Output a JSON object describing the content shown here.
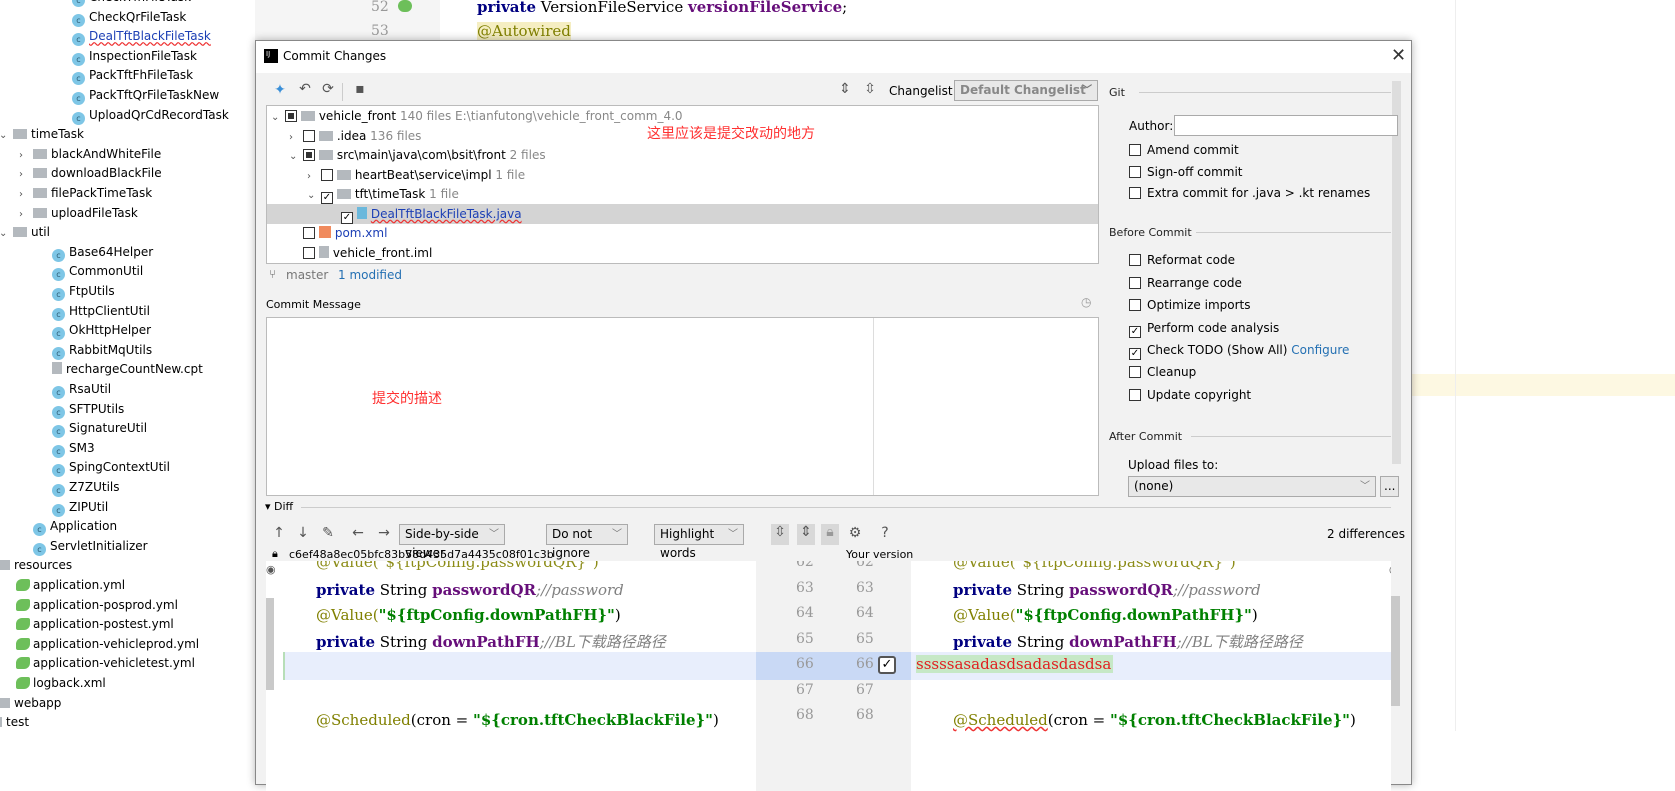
{
  "project_tree": {
    "items": [
      {
        "label": "CheckTfhFileTask",
        "icon": "class-icon"
      },
      {
        "label": "CheckQrFileTask",
        "icon": "class-icon"
      },
      {
        "label": "DealTftBlackFileTask",
        "icon": "class-icon"
      },
      {
        "label": "InspectionFileTask",
        "icon": "class-icon"
      },
      {
        "label": "PackTftFhFileTask",
        "icon": "class-icon"
      },
      {
        "label": "PackTftQrFileTaskNew",
        "icon": "class-icon"
      },
      {
        "label": "UploadQrCdRecordTask",
        "icon": "class-icon"
      },
      {
        "label": "timeTask",
        "icon": "folder-icon"
      },
      {
        "label": "blackAndWhiteFile",
        "icon": "folder-icon"
      },
      {
        "label": "downloadBlackFile",
        "icon": "folder-icon"
      },
      {
        "label": "filePackTimeTask",
        "icon": "folder-icon"
      },
      {
        "label": "uploadFileTask",
        "icon": "folder-icon"
      },
      {
        "label": "util",
        "icon": "folder-icon"
      },
      {
        "label": "Base64Helper",
        "icon": "class-icon"
      },
      {
        "label": "CommonUtil",
        "icon": "class-icon"
      },
      {
        "label": "FtpUtils",
        "icon": "class-icon"
      },
      {
        "label": "HttpClientUtil",
        "icon": "class-icon"
      },
      {
        "label": "OkHttpHelper",
        "icon": "class-icon"
      },
      {
        "label": "RabbitMqUtils",
        "icon": "class-icon"
      },
      {
        "label": "rechargeCountNew.cpt",
        "icon": "file-icon"
      },
      {
        "label": "RsaUtil",
        "icon": "class-icon"
      },
      {
        "label": "SFTPUtils",
        "icon": "class-icon"
      },
      {
        "label": "SignatureUtil",
        "icon": "class-icon"
      },
      {
        "label": "SM3",
        "icon": "class-icon"
      },
      {
        "label": "SpingContextUtil",
        "icon": "class-icon"
      },
      {
        "label": "Z7ZUtils",
        "icon": "class-icon"
      },
      {
        "label": "ZIPUtil",
        "icon": "class-icon"
      },
      {
        "label": "Application",
        "icon": "spring-class-icon"
      },
      {
        "label": "ServletInitializer",
        "icon": "class-icon"
      },
      {
        "label": "resources",
        "icon": "resources-folder-icon"
      },
      {
        "label": "application.yml",
        "icon": "yaml-icon"
      },
      {
        "label": "application-posprod.yml",
        "icon": "yaml-icon"
      },
      {
        "label": "application-postest.yml",
        "icon": "yaml-icon"
      },
      {
        "label": "application-vehicleprod.yml",
        "icon": "yaml-icon"
      },
      {
        "label": "application-vehicletest.yml",
        "icon": "yaml-icon"
      },
      {
        "label": "logback.xml",
        "icon": "xml-icon"
      },
      {
        "label": "webapp",
        "icon": "folder-icon"
      },
      {
        "label": "test",
        "icon": "folder-icon"
      }
    ]
  },
  "editor": {
    "lines": [
      {
        "num": "52",
        "kw": "private",
        "type": " VersionFileService ",
        "field": "versionFileService",
        "end": ";"
      },
      {
        "num": "53",
        "annotation": "@Autowired"
      }
    ]
  },
  "dialog": {
    "title": "Commit Changes",
    "changelist_label": "Changelist:",
    "changelist_value": "Default Changelist",
    "tree": [
      {
        "name": "vehicle_front",
        "count": "140 files",
        "path": "E:\\tianfutong\\vehicle_front_comm_4.0"
      },
      {
        "name": ".idea",
        "count": "136 files"
      },
      {
        "name": "src\\main\\java\\com\\bsit\\front",
        "count": "2 files"
      },
      {
        "name": "heartBeat\\service\\impl",
        "count": "1 file"
      },
      {
        "name": "tft\\timeTask",
        "count": "1 file"
      },
      {
        "name": "DealTftBlackFileTask.java"
      },
      {
        "name": "pom.xml"
      },
      {
        "name": "vehicle_front.iml"
      }
    ],
    "annotation_tree": "这里应该是提交改动的地方",
    "branch": "master",
    "modified": "1 modified",
    "commit_message_label": "Commit Message",
    "commit_message_note": "提交的描述",
    "git_section": "Git",
    "author_label": "Author:",
    "author_value": "",
    "git_options": [
      {
        "label": "Amend commit",
        "checked": false
      },
      {
        "label": "Sign-off commit",
        "checked": false
      },
      {
        "label": "Extra commit for .java > .kt renames",
        "checked": false
      }
    ],
    "before_commit_section": "Before Commit",
    "before_options": [
      {
        "label": "Reformat code",
        "checked": false
      },
      {
        "label": "Rearrange code",
        "checked": false
      },
      {
        "label": "Optimize imports",
        "checked": false
      },
      {
        "label": "Perform code analysis",
        "checked": true
      },
      {
        "label": "Check TODO (Show All)",
        "checked": true,
        "link": "Configure"
      },
      {
        "label": "Cleanup",
        "checked": false
      },
      {
        "label": "Update copyright",
        "checked": false
      }
    ],
    "after_commit_section": "After Commit",
    "upload_label": "Upload files to:",
    "upload_value": "(none)",
    "browse_label": "...",
    "diff": {
      "label": "Diff",
      "viewer": "Side-by-side viewer",
      "ignore": "Do not ignore",
      "highlight": "Highlight words",
      "help": "?",
      "differences": "2 differences",
      "hash": "c6ef48a8ec05bfc83b58d435d7a4435c08f01c3b",
      "your_version": "Your version",
      "line_numbers": [
        "62",
        "63",
        "64",
        "65",
        "66",
        "67",
        "68"
      ],
      "added_line": "sssssasadasdsadasdasdsa",
      "code": {
        "l62": "@Value(\"${ftpConfig.passwordQR}\")",
        "private": "private",
        "string": " String ",
        "f63": "passwordQR",
        "c63": ";//password",
        "value64": "@Value(",
        "s64": "\"${ftpConfig.downPathFH}\"",
        "close64": ")",
        "f65": "downPathFH",
        "c65": ";//BL下载路径路径",
        "sched": "@Scheduled",
        "cron_pre": "(cron = ",
        "cron_str": "\"${cron.tftCheckBlackFile}\"",
        "cron_close": ")"
      }
    }
  },
  "colors": {
    "accent": "#2470b3",
    "annotation_red": "#ff3030",
    "added_bg": "#c6e8c6",
    "changed_line_bg": "#e8eefc",
    "gutter_changed": "#c9d9f5"
  }
}
